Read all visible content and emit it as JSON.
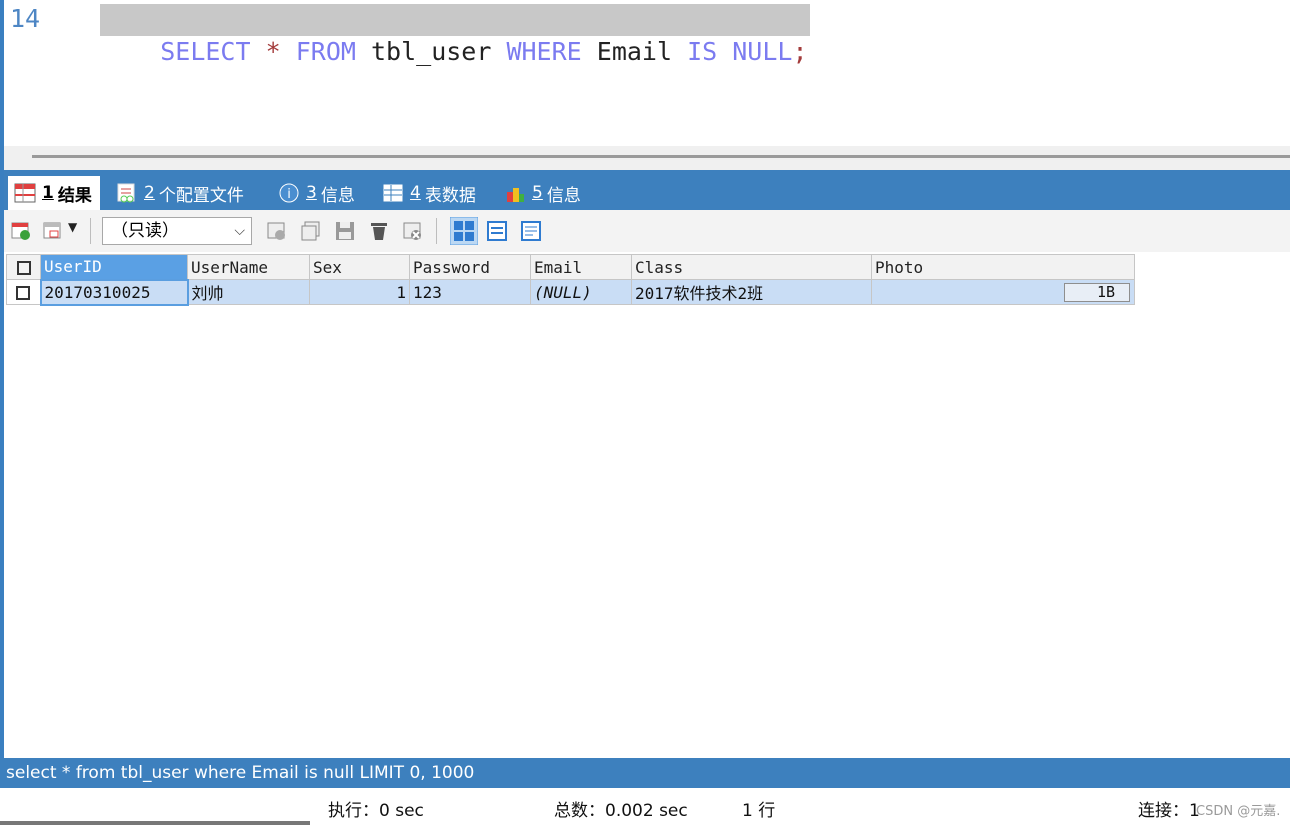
{
  "editor": {
    "line_number": "14",
    "sql_tokens": [
      {
        "text": "SELECT",
        "kind": "kw"
      },
      {
        "text": " ",
        "kind": "id"
      },
      {
        "text": "*",
        "kind": "op"
      },
      {
        "text": " ",
        "kind": "id"
      },
      {
        "text": "FROM",
        "kind": "kw"
      },
      {
        "text": " tbl_user ",
        "kind": "id"
      },
      {
        "text": "WHERE",
        "kind": "kw"
      },
      {
        "text": " Email ",
        "kind": "id"
      },
      {
        "text": "IS",
        "kind": "kw"
      },
      {
        "text": " ",
        "kind": "id"
      },
      {
        "text": "NULL",
        "kind": "kw"
      },
      {
        "text": ";",
        "kind": "op"
      }
    ]
  },
  "tabs": [
    {
      "num": "1",
      "label": "结果",
      "icon": "table-result-icon",
      "active": true
    },
    {
      "num": "2",
      "label": "个配置文件",
      "icon": "profile-icon",
      "active": false
    },
    {
      "num": "3",
      "label": "信息",
      "icon": "info-icon",
      "active": false
    },
    {
      "num": "4",
      "label": "表数据",
      "icon": "table-data-icon",
      "active": false
    },
    {
      "num": "5",
      "label": "信息",
      "icon": "chart-info-icon",
      "active": false
    }
  ],
  "toolbar": {
    "mode_select": "（只读）"
  },
  "grid": {
    "columns": [
      "UserID",
      "UserName",
      "Sex",
      "Password",
      "Email",
      "Class",
      "Photo"
    ],
    "rows": [
      {
        "UserID": "20170310025",
        "UserName": "刘帅",
        "Sex": "1",
        "Password": "123",
        "Email": "(NULL)",
        "Class": "2017软件技术2班",
        "Photo": "1B"
      }
    ]
  },
  "status": {
    "query": "select * from tbl_user where Email is null LIMIT 0, 1000",
    "exec": "执行：0 sec",
    "total": "总数：0.002 sec",
    "rows": "1 行",
    "conn": "连接：1"
  },
  "watermark": "CSDN @元嘉."
}
